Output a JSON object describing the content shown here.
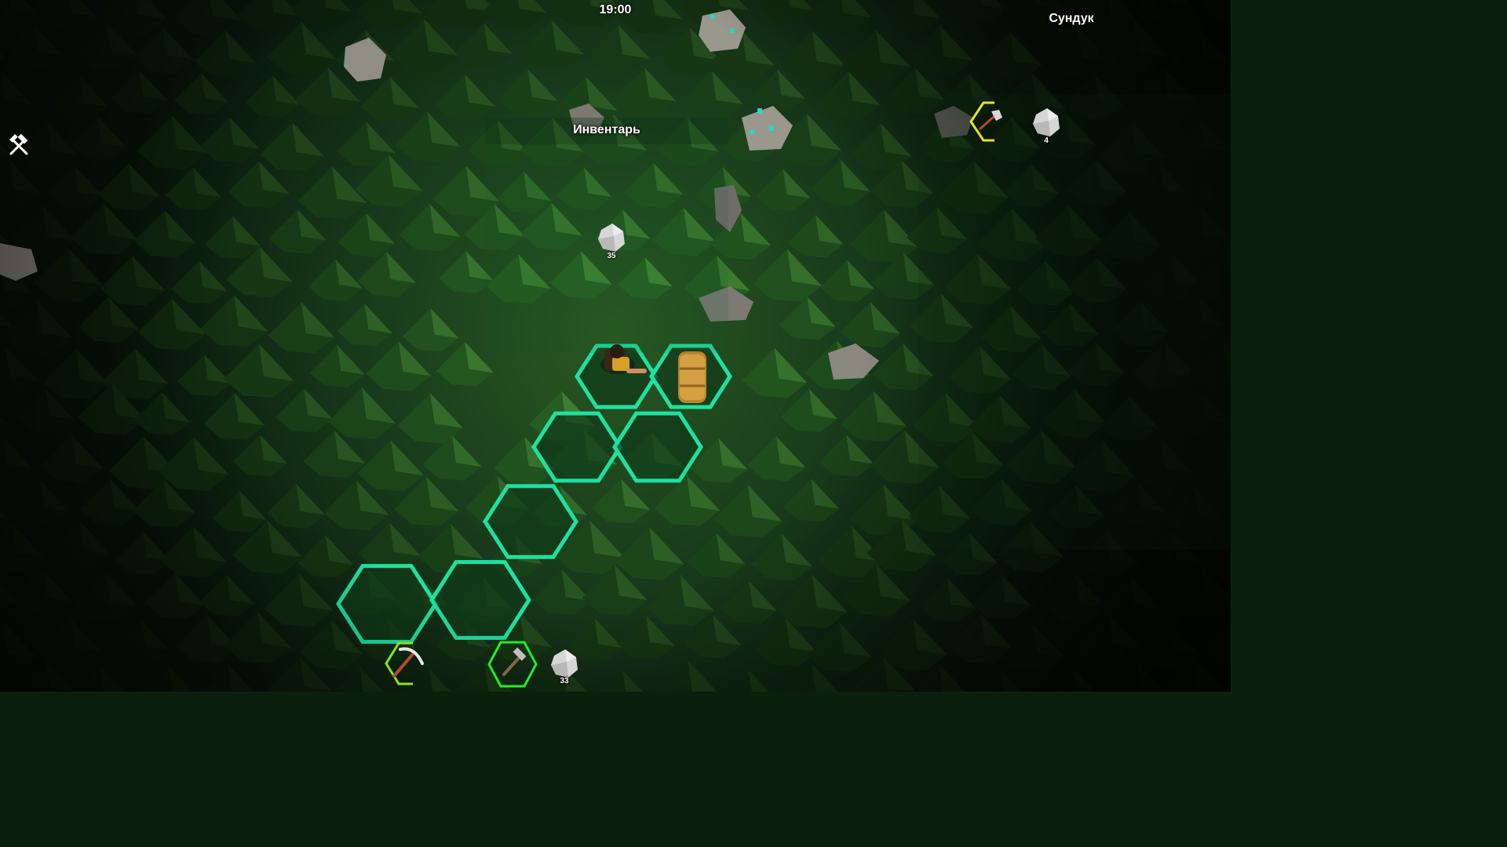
{
  "hud": {
    "clock": "19:00",
    "build_icon": "hammer-icon"
  },
  "inventory": {
    "title": "Инвентарь",
    "items": [
      {
        "icon": "stone-icon",
        "count": "35"
      }
    ]
  },
  "chest": {
    "title": "Сундук",
    "items": [
      {
        "icon": "axe-icon",
        "count": ""
      },
      {
        "icon": "stone-icon",
        "count": "4"
      }
    ]
  },
  "hotbar": {
    "slots": [
      {
        "icon": "pickaxe-icon",
        "count": ""
      },
      {
        "icon": "hammer-icon",
        "count": "",
        "selected": true
      },
      {
        "icon": "stone-icon",
        "count": "33"
      }
    ]
  },
  "colors": {
    "grid_highlight": "#1fe0a0",
    "chest_slot_highlight": "#e5e51a",
    "hotbar_highlight": "#88e51a",
    "hotbar_selected": "#22ee22"
  }
}
